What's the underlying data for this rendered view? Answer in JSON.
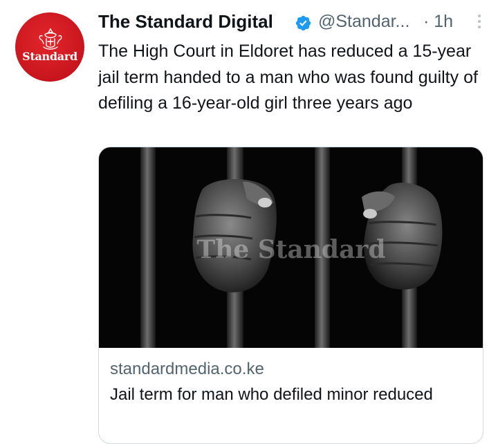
{
  "author": {
    "display_name": "The Standard Digital",
    "handle": "@Standar...",
    "time": "· 1h",
    "avatar_text": "Standard",
    "verified": true
  },
  "tweet": {
    "text": "The High Court in Eldoret has reduced a 15-year jail term handed to a man who was found guilty of defiling a 16-year-old girl three years ago"
  },
  "card": {
    "image_watermark": "The Standard",
    "domain": "standardmedia.co.ke",
    "title": "Jail term for man who defiled minor reduced"
  },
  "colors": {
    "brand_red": "#d01a22",
    "verified_blue": "#1d9bf0",
    "secondary_text": "#536471",
    "border": "#cfd9de"
  },
  "icons": [
    "verified-badge-icon",
    "more-options-icon"
  ]
}
